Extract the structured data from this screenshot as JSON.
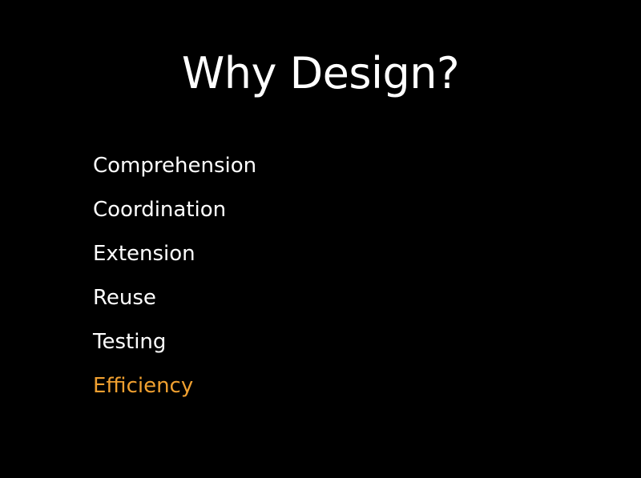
{
  "slide": {
    "title": "Why Design?",
    "items": [
      {
        "label": "Comprehension",
        "highlighted": false
      },
      {
        "label": "Coordination",
        "highlighted": false
      },
      {
        "label": "Extension",
        "highlighted": false
      },
      {
        "label": "Reuse",
        "highlighted": false
      },
      {
        "label": "Testing",
        "highlighted": false
      },
      {
        "label": "Efficiency",
        "highlighted": true
      }
    ]
  },
  "colors": {
    "background": "#000000",
    "text": "#ffffff",
    "highlight": "#f0a030"
  }
}
